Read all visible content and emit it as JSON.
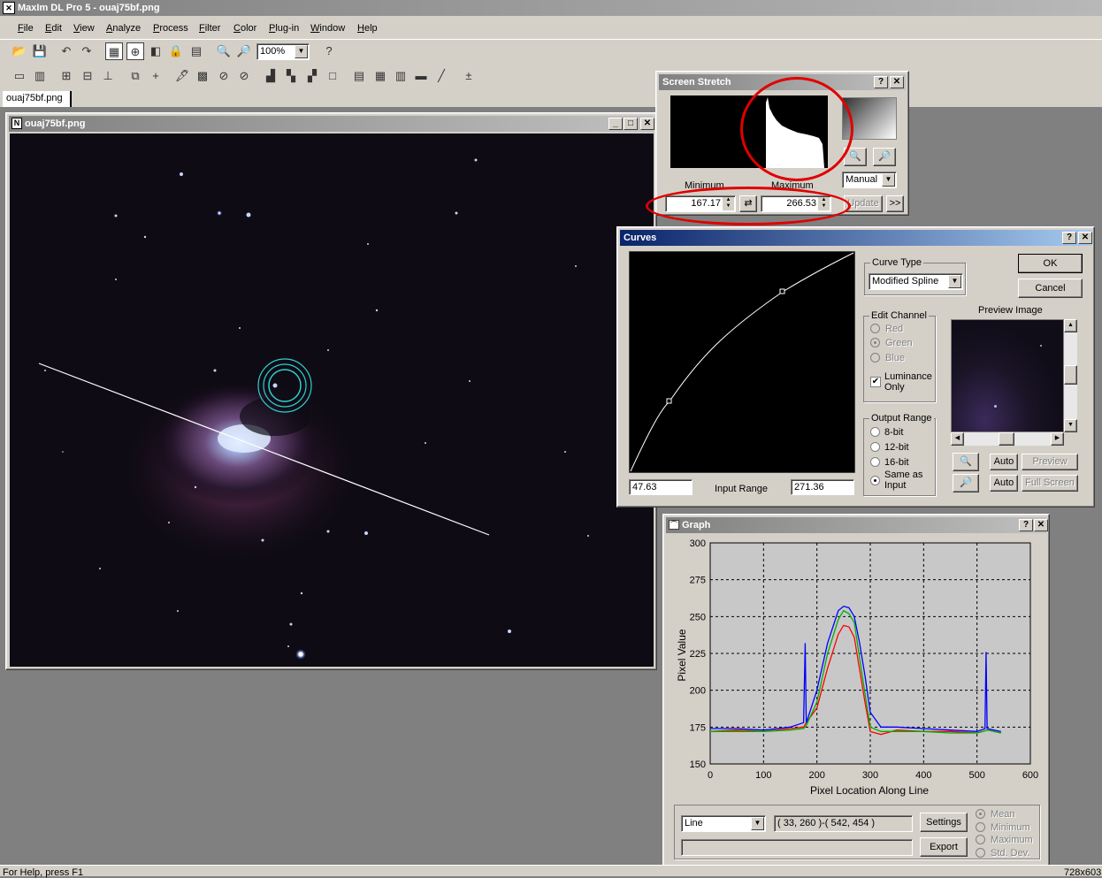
{
  "app": {
    "title": "MaxIm DL Pro 5 - ouaj75bf.png"
  },
  "menu": [
    "File",
    "Edit",
    "View",
    "Analyze",
    "Process",
    "Filter",
    "Color",
    "Plug-in",
    "Window",
    "Help"
  ],
  "toolbar": {
    "zoom": "100%"
  },
  "doc_tab": "ouaj75bf.png",
  "image_window": {
    "title": "ouaj75bf.png"
  },
  "screen_stretch": {
    "title": "Screen Stretch",
    "minimum_label": "Minimum",
    "maximum_label": "Maximum",
    "minimum": "167.17",
    "maximum": "266.53",
    "mode": "Manual",
    "update": "Update",
    "more": ">>"
  },
  "curves": {
    "title": "Curves",
    "curve_type_label": "Curve Type",
    "curve_type": "Modified Spline",
    "ok": "OK",
    "cancel": "Cancel",
    "edit_channel_label": "Edit Channel",
    "channels": [
      "Red",
      "Green",
      "Blue"
    ],
    "luminance_only": "Luminance Only",
    "output_range_label": "Output Range",
    "output_ranges": [
      "8-bit",
      "12-bit",
      "16-bit",
      "Same as Input"
    ],
    "preview_label": "Preview Image",
    "auto": "Auto",
    "preview": "Preview",
    "full_screen": "Full Screen",
    "input_min": "47.63",
    "input_range_label": "Input Range",
    "input_max": "271.36"
  },
  "graph": {
    "title": "Graph",
    "mode": "Line",
    "coords": "( 33, 260 )-( 542, 454 )",
    "settings": "Settings",
    "export": "Export",
    "stats": [
      "Mean",
      "Minimum",
      "Maximum",
      "Std. Dev."
    ],
    "xlabel": "Pixel Location Along Line",
    "ylabel": "Pixel Value"
  },
  "chart_data": {
    "type": "line",
    "xlabel": "Pixel Location Along Line",
    "ylabel": "Pixel Value",
    "xlim": [
      0,
      600
    ],
    "ylim": [
      150,
      300
    ],
    "xticks": [
      0,
      100,
      200,
      300,
      400,
      500,
      600
    ],
    "yticks": [
      150,
      175,
      200,
      225,
      250,
      275,
      300
    ],
    "grid": true,
    "series": [
      {
        "color": "#ff0000",
        "x": [
          0,
          50,
          100,
          150,
          175,
          180,
          200,
          220,
          240,
          250,
          260,
          270,
          280,
          290,
          300,
          320,
          350,
          400,
          450,
          500,
          510,
          520,
          545
        ],
        "y": [
          172,
          173,
          172,
          174,
          175,
          178,
          188,
          215,
          238,
          244,
          243,
          236,
          214,
          192,
          172,
          170,
          173,
          172,
          172,
          171,
          172,
          173,
          171
        ]
      },
      {
        "color": "#00b000",
        "x": [
          0,
          50,
          100,
          150,
          175,
          180,
          200,
          220,
          240,
          250,
          260,
          270,
          280,
          290,
          300,
          320,
          350,
          400,
          450,
          500,
          510,
          520,
          545
        ],
        "y": [
          172,
          172,
          172,
          173,
          174,
          176,
          192,
          225,
          248,
          254,
          252,
          246,
          222,
          198,
          175,
          172,
          172,
          172,
          171,
          171,
          172,
          173,
          171
        ]
      },
      {
        "color": "#0000ff",
        "x": [
          0,
          50,
          100,
          150,
          175,
          178,
          180,
          182,
          200,
          220,
          240,
          250,
          260,
          270,
          280,
          290,
          300,
          320,
          350,
          400,
          450,
          500,
          515,
          517,
          519,
          545
        ],
        "y": [
          174,
          174,
          173,
          175,
          178,
          232,
          178,
          180,
          200,
          232,
          254,
          257,
          256,
          250,
          232,
          210,
          185,
          175,
          175,
          174,
          173,
          172,
          174,
          226,
          174,
          172
        ]
      }
    ]
  },
  "status": {
    "help": "For Help, press F1",
    "size": "728x603"
  }
}
